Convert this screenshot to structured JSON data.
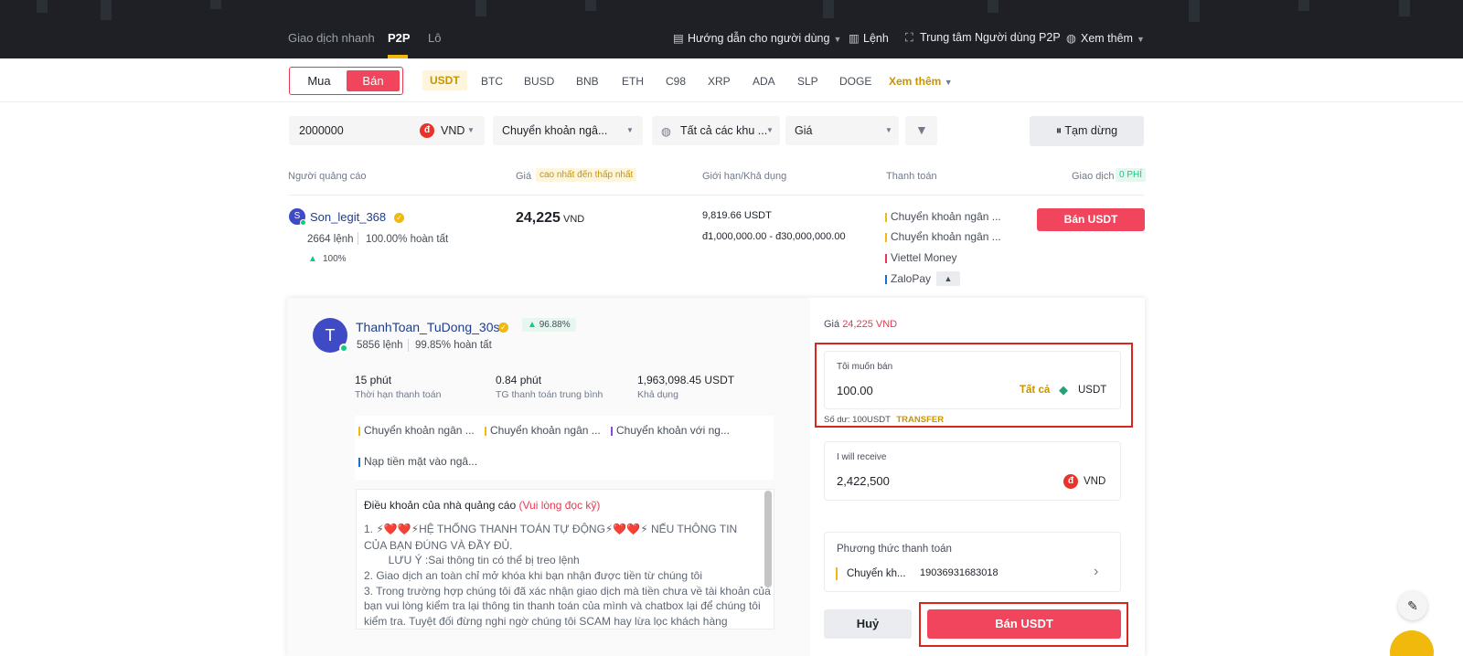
{
  "topnav": {
    "tabs": [
      "Giao dịch nhanh",
      "P2P",
      "Lô"
    ],
    "guide": "Hướng dẫn cho người dùng",
    "orders": "Lệnh",
    "user_center": "Trung tâm Người dùng P2P",
    "more": "Xem thêm"
  },
  "trade_toggle": {
    "buy": "Mua",
    "sell": "Bán"
  },
  "coins": [
    "USDT",
    "BTC",
    "BUSD",
    "BNB",
    "ETH",
    "C98",
    "XRP",
    "ADA",
    "SLP",
    "DOGE"
  ],
  "coins_more": "Xem thêm",
  "filters": {
    "amount": "2000000",
    "currency": "VND",
    "payment": "Chuyển khoản ngâ...",
    "region": "Tất cả các khu ...",
    "sort": "Giá",
    "pause": "Tạm dừng"
  },
  "table_header": {
    "advertiser": "Người quảng cáo",
    "price": "Giá",
    "price_sort": "cao nhất đến thấp nhất",
    "limit": "Giới hạn/Khả dụng",
    "payment": "Thanh toán",
    "trade": "Giao dịch",
    "fee": "0 PHÍ"
  },
  "listing": {
    "avatar_letter": "S",
    "name": "Son_legit_368",
    "orders": "2664 lệnh",
    "completion": "100.00% hoàn tất",
    "rating": "100%",
    "price": "24,225",
    "price_unit": "VND",
    "available": "9,819.66 USDT",
    "limit": "đ1,000,000.00 - đ30,000,000.00",
    "payments": [
      "Chuyển khoản ngân ...",
      "Chuyển khoản ngân ...",
      "Viettel Money",
      "ZaloPay"
    ],
    "payment_colors": [
      "#f0b90b",
      "#f0b90b",
      "#e53950",
      "#1c6dd0"
    ],
    "action": "Bán USDT"
  },
  "detail": {
    "avatar_letter": "T",
    "name": "ThanhToan_TuDong_30s",
    "rating": "96.88%",
    "orders": "5856 lệnh",
    "completion": "99.85% hoàn tất",
    "stats": [
      {
        "value": "15 phút",
        "label": "Thời hạn thanh toán"
      },
      {
        "value": "0.84 phút",
        "label": "TG thanh toán trung bình"
      },
      {
        "value": "1,963,098.45 USDT",
        "label": "Khả dụng"
      }
    ],
    "payments": [
      "Chuyển khoản ngân ...",
      "Chuyển khoản ngân ...",
      "Chuyển khoản với ng...",
      "Nạp tiền mặt vào ngâ..."
    ],
    "payment_colors": [
      "#f0b90b",
      "#f0b90b",
      "#8a4bd6",
      "#1c6dd0"
    ],
    "terms_title": "Điều khoản của nhà quảng cáo",
    "terms_note": "(Vui lòng đọc kỹ)",
    "terms_lines": [
      "1. ⚡❤️❤️⚡HỆ THỐNG THANH TOÁN TỰ ĐỘNG⚡❤️❤️⚡ NẾU THÔNG TIN",
      "CỦA BẠN ĐÚNG VÀ ĐẦY ĐỦ.",
      "        LƯU Ý :Sai thông tin có thể bị treo lệnh",
      "2. Giao dịch an toàn chỉ mở khóa khi bạn nhận được tiền từ chúng tôi",
      "3. Trong trường hợp chúng tôi đã xác nhận giao dịch mà tiền chưa về tài khoản của",
      "bạn vui lòng kiểm tra lại thông tin thanh toán của mình và chatbox lại để chúng tôi",
      "kiểm tra. Tuyệt đối đừng nghi ngờ chúng tôi SCAM hay lừa lọc khách hàng"
    ]
  },
  "form": {
    "price_label": "Giá",
    "price_value": "24,225 VND",
    "sell_label": "Tôi muốn bán",
    "sell_value": "100.00",
    "all": "Tất cả",
    "sell_unit": "USDT",
    "balance": "Số dư: 100USDT",
    "transfer": "TRANSFER",
    "receive_label": "I will receive",
    "receive_value": "2,422,500",
    "receive_unit": "VND",
    "method_label": "Phương thức thanh toán",
    "method_name": "Chuyển kh...",
    "method_account": "19036931683018",
    "cancel": "Huỷ",
    "submit": "Bán USDT"
  }
}
